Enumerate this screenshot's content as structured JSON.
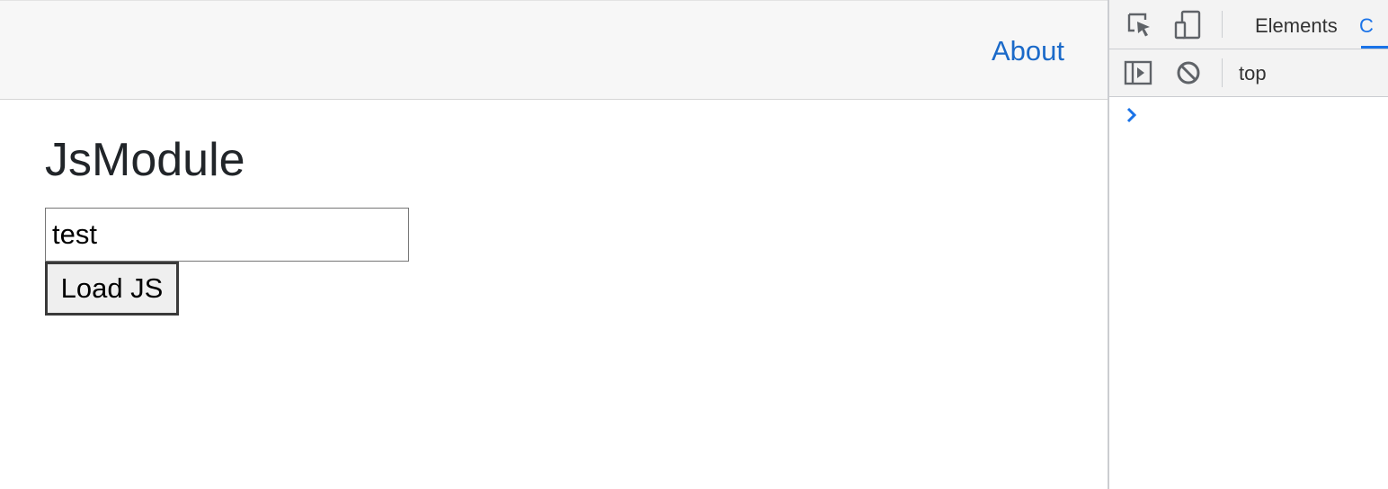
{
  "page": {
    "nav": {
      "about_label": "About"
    },
    "title": "JsModule",
    "module_input": {
      "value": "test"
    },
    "load_button_label": "Load JS"
  },
  "devtools": {
    "tabs": [
      {
        "label": "Elements",
        "active": false
      },
      {
        "label": "C",
        "active": true
      }
    ],
    "toolbar": {
      "context_label": "top"
    },
    "console_prompt": "›",
    "icons": {
      "inspect": "inspect-element-icon",
      "device": "device-toolbar-icon",
      "sidebar": "show-console-sidebar-icon",
      "clear": "clear-console-icon"
    },
    "accent_color": "#1a73e8"
  },
  "colors": {
    "link": "#1b6ac9",
    "topbar_bg": "#f7f7f7",
    "button_bg": "#efefef"
  }
}
